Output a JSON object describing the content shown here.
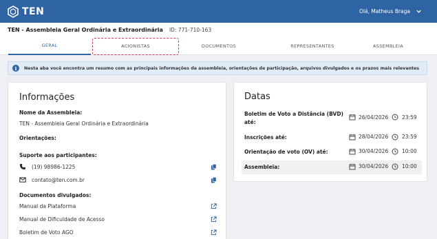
{
  "app": {
    "logo_text": "TEN"
  },
  "user": {
    "greeting": "Olá, Matheus Braga"
  },
  "assembly": {
    "title": "TEN - Assembleia Geral Ordinária e Extraordinária",
    "id_label": "ID: 771-710-163"
  },
  "tabs": [
    {
      "label": "GERAL",
      "active": true
    },
    {
      "label": "ACIONISTAS",
      "active": false
    },
    {
      "label": "DOCUMENTOS",
      "active": false
    },
    {
      "label": "REPRESENTANTES",
      "active": false
    },
    {
      "label": "ASSEMBLEIA",
      "active": false
    }
  ],
  "info_banner": "Nesta aba você encontra um resumo com as principais informações da assembleia, orientações de participação, arquivos divulgados e os prazos mais relevantes",
  "informacoes": {
    "heading": "Informações",
    "nome_label": "Nome da Assembleia:",
    "nome_value": "TEN - Assembleia Geral Ordinária e Extraordinária",
    "orientacoes_label": "Orientações:",
    "suporte_label": "Suporte aos participantes:",
    "phone": "(19) 98986-1225",
    "email": "contato@ten.com.br",
    "docs_label": "Documentos divulgados:",
    "documents": [
      "Manual da Plataforma",
      "Manual de Dificuldade de Acesso",
      "Boletim de Voto AGO"
    ]
  },
  "datas": {
    "heading": "Datas",
    "rows": [
      {
        "label_line1": "Boletim de Voto a Distância (BVD)",
        "label_line2": "até:",
        "date": "26/04/2026",
        "time": "23:59"
      },
      {
        "label_line1": "Inscrições até:",
        "label_line2": "",
        "date": "28/04/2026",
        "time": "23:59"
      },
      {
        "label_line1": "Orientação de voto (OV) até:",
        "label_line2": "",
        "date": "30/04/2026",
        "time": "10:00"
      },
      {
        "label_line1": "Assembleia:",
        "label_line2": "",
        "date": "30/04/2026",
        "time": "10:00"
      }
    ]
  },
  "colors": {
    "brand": "#2f64a4",
    "highlight": "#d9365a"
  }
}
